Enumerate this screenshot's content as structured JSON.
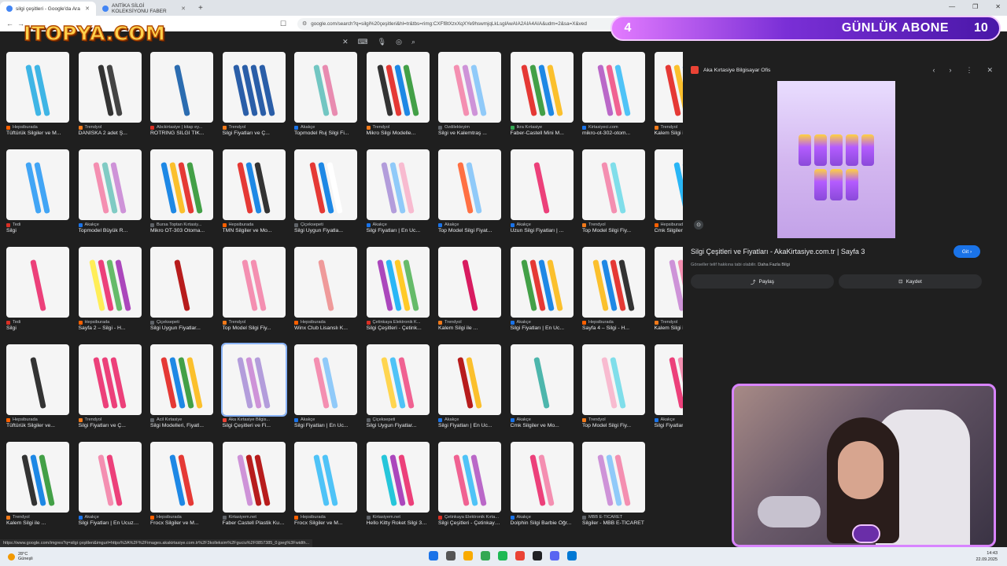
{
  "tabs": [
    {
      "label": "silgi çeşitleri - Google'da Ara",
      "active": true
    },
    {
      "label": "ANTİKA SİLGİ KOLEKSİYONU FABER",
      "active": false
    }
  ],
  "url": "google.com/search?q=silgi%20çeşitleri&hl=tr&tbs=rimg:CXFf8tXzxXqXYe9hswmjqLkLsglAwAIA2AIA4AIA&udm=2&sa=X&ved",
  "overlay": {
    "logo": "ITOPYA.COM",
    "sub_count_left": "4",
    "sub_label": "GÜNLÜK ABONE",
    "sub_count_right": "10"
  },
  "grid": [
    [
      {
        "source": "Hepsiburada",
        "title": "Tüftürük Silgiler ve M...",
        "src_color": "#ff6000",
        "colors": [
          "#3fb5e5",
          "#3fb5e5"
        ]
      },
      {
        "source": "Trendyol",
        "title": "DANİSKA 2 adet Ş...",
        "src_color": "#f27a1a",
        "colors": [
          "#333333",
          "#444444"
        ]
      },
      {
        "source": "Abckirtasiye | kitap ey...",
        "title": "ROTRİNG SİLGİ TİK...",
        "src_color": "#d93025",
        "colors": [
          "#2b6cb0"
        ]
      },
      {
        "source": "Trendyol",
        "title": "Silgi Fiyatları ve Ç...",
        "src_color": "#f27a1a",
        "colors": [
          "#2a5ea8",
          "#2a5ea8",
          "#2a5ea8",
          "#2a5ea8"
        ]
      },
      {
        "source": "Akakçe",
        "title": "Topmodel Ruj Silgi Fi...",
        "src_color": "#1a73e8",
        "colors": [
          "#72c6c2",
          "#e88bb0"
        ]
      },
      {
        "source": "Trendyol",
        "title": "Mikro Silgi Modelle...",
        "src_color": "#f27a1a",
        "colors": [
          "#333333",
          "#e53935",
          "#1e88e5",
          "#43a047"
        ]
      },
      {
        "source": "Özdilekteyim",
        "title": "Silgi ve Kalemtraş ...",
        "src_color": "#5f6368",
        "colors": [
          "#f48fb1",
          "#ce93d8",
          "#90caf9"
        ]
      },
      {
        "source": "İkra Kırtasiye",
        "title": "Faber-Castell Mini M...",
        "src_color": "#34a853",
        "colors": [
          "#e53935",
          "#43a047",
          "#1e88e5",
          "#fbc02d"
        ]
      },
      {
        "source": "Kirtasiyeci.com",
        "title": "mikro-ot-302-otom...",
        "src_color": "#1a73e8",
        "colors": [
          "#ba68c8",
          "#f06292",
          "#4fc3f7"
        ]
      },
      {
        "source": "Trendyol",
        "title": "Kalem Silgi ile ...",
        "src_color": "#f27a1a",
        "colors": [
          "#e53935",
          "#fbc02d",
          "#1e88e5",
          "#43a047"
        ]
      }
    ],
    [
      {
        "source": "Tedi",
        "title": "Silgi",
        "src_color": "#d93025",
        "colors": [
          "#42a5f5",
          "#42a5f5"
        ]
      },
      {
        "source": "Akakçe",
        "title": "Topmodel Büyük R...",
        "src_color": "#1a73e8",
        "colors": [
          "#f48fb1",
          "#80cbc4",
          "#ce93d8"
        ]
      },
      {
        "source": "Bursa Toptan Kırtasiy...",
        "title": "Mikro OT-303 Otoma...",
        "src_color": "#5f6368",
        "colors": [
          "#1e88e5",
          "#fbc02d",
          "#e53935",
          "#43a047"
        ]
      },
      {
        "source": "Hepsiburada",
        "title": "TMN Silgiler ve Mo...",
        "src_color": "#ff6000",
        "colors": [
          "#e53935",
          "#1e88e5",
          "#333333"
        ]
      },
      {
        "source": "Çiçeksepeti",
        "title": "Silgi Uygun Fiyatla...",
        "src_color": "#5f6368",
        "colors": [
          "#e53935",
          "#1e88e5",
          "#ffffff"
        ]
      },
      {
        "source": "Akakçe",
        "title": "Silgi Fiyatları | En Uc...",
        "src_color": "#1a73e8",
        "colors": [
          "#b39ddb",
          "#90caf9",
          "#f8bbd0"
        ]
      },
      {
        "source": "Akakçe",
        "title": "Top Model Silgi Fiyat...",
        "src_color": "#1a73e8",
        "colors": [
          "#ff7043",
          "#90caf9"
        ]
      },
      {
        "source": "Akakçe",
        "title": "Uzun Silgi Fiyatları | ...",
        "src_color": "#1a73e8",
        "colors": [
          "#ec407a"
        ]
      },
      {
        "source": "Trendyol",
        "title": "Top Model Silgi Fiy...",
        "src_color": "#f27a1a",
        "colors": [
          "#f48fb1",
          "#80deea"
        ]
      },
      {
        "source": "Hepsiburada",
        "title": "Cmk Silgiler ve Mo...",
        "src_color": "#ff6000",
        "colors": [
          "#29b6f6",
          "#29b6f6"
        ]
      }
    ],
    [
      {
        "source": "Tedi",
        "title": "Silgi",
        "src_color": "#d93025",
        "colors": [
          "#ec407a"
        ]
      },
      {
        "source": "Hepsiburada",
        "title": "Sayfa 2 – Silgi - H...",
        "src_color": "#ff6000",
        "colors": [
          "#ffee58",
          "#ec407a",
          "#66bb6a",
          "#ab47bc"
        ]
      },
      {
        "source": "Çiçeksepeti",
        "title": "Silgi Uygun Fiyatlar...",
        "src_color": "#5f6368",
        "colors": [
          "#b71c1c"
        ]
      },
      {
        "source": "Trendyol",
        "title": "Top Model Silgi Fiy...",
        "src_color": "#f27a1a",
        "colors": [
          "#f48fb1",
          "#f48fb1"
        ]
      },
      {
        "source": "Hepsiburada",
        "title": "Winx Club Lisanslı K...",
        "src_color": "#ff6000",
        "colors": [
          "#ef9a9a"
        ]
      },
      {
        "source": "Çetinkaya Elektronik K...",
        "title": "Silgi Çeşitleri - Çetink...",
        "src_color": "#d93025",
        "colors": [
          "#ab47bc",
          "#29b6f6",
          "#ffca28",
          "#66bb6a"
        ]
      },
      {
        "source": "Trendyol",
        "title": "Kalem Silgi ile ...",
        "src_color": "#f27a1a",
        "colors": [
          "#d81b60"
        ]
      },
      {
        "source": "Akakçe",
        "title": "Silgi Fiyatları | En Uc...",
        "src_color": "#1a73e8",
        "colors": [
          "#43a047",
          "#e53935",
          "#1e88e5",
          "#fbc02d"
        ]
      },
      {
        "source": "Hepsiburada",
        "title": "Sayfa 4 – Silgi - H...",
        "src_color": "#ff6000",
        "colors": [
          "#fbc02d",
          "#1e88e5",
          "#e53935",
          "#333333"
        ]
      },
      {
        "source": "Trendyol",
        "title": "Kalem Silgi ile ...",
        "src_color": "#f27a1a",
        "colors": [
          "#ce93d8",
          "#f48fb1",
          "#90caf9"
        ]
      }
    ],
    [
      {
        "source": "Hepsiburada",
        "title": "Tüftürük Silgiler ve...",
        "src_color": "#ff6000",
        "colors": [
          "#333333"
        ]
      },
      {
        "source": "Trendyol",
        "title": "Silgi Fiyatları ve Ç...",
        "src_color": "#f27a1a",
        "colors": [
          "#ec407a",
          "#ec407a",
          "#ec407a"
        ]
      },
      {
        "source": "Acil Kırtasiye",
        "title": "Silgi Modelleri, Fiyatl...",
        "src_color": "#5f6368",
        "colors": [
          "#e53935",
          "#1e88e5",
          "#43a047",
          "#fbc02d"
        ]
      },
      {
        "source": "Aka Kırtasiye Bilgis...",
        "title": "Silgi Çeşitleri ve Fi...",
        "src_color": "#ea4335",
        "colors": [
          "#b39ddb",
          "#ce93d8",
          "#b39ddb"
        ],
        "selected": true
      },
      {
        "source": "Akakçe",
        "title": "Silgi Fiyatları | En Uc...",
        "src_color": "#1a73e8",
        "colors": [
          "#f48fb1",
          "#90caf9"
        ]
      },
      {
        "source": "Çiçeksepeti",
        "title": "Silgi Uygun Fiyatlar...",
        "src_color": "#5f6368",
        "colors": [
          "#ffd54f",
          "#4fc3f7",
          "#f06292"
        ]
      },
      {
        "source": "Akakçe",
        "title": "Silgi Fiyatları | En Uc...",
        "src_color": "#1a73e8",
        "colors": [
          "#b71c1c",
          "#fbc02d"
        ]
      },
      {
        "source": "Akakçe",
        "title": "Cmk Silgiler ve Mo...",
        "src_color": "#1a73e8",
        "colors": [
          "#4db6ac"
        ]
      },
      {
        "source": "Trendyol",
        "title": "Top Model Silgi Fiy...",
        "src_color": "#f27a1a",
        "colors": [
          "#f8bbd0",
          "#80deea"
        ]
      },
      {
        "source": "Akakçe",
        "title": "Silgi Fiyatları | En Uc...",
        "src_color": "#1a73e8",
        "colors": [
          "#ec407a",
          "#f48fb1",
          "#ec407a"
        ]
      }
    ],
    [
      {
        "source": "Trendyol",
        "title": "Kalem Silgi ile ...",
        "src_color": "#f27a1a",
        "colors": [
          "#333333",
          "#1e88e5",
          "#43a047"
        ]
      },
      {
        "source": "Akakçe",
        "title": "Silgi Fiyatları | En Ucuzu ...",
        "src_color": "#1a73e8",
        "colors": [
          "#f48fb1",
          "#ec407a"
        ]
      },
      {
        "source": "Hepsiburada",
        "title": "Frocx Silgiler ve M...",
        "src_color": "#ff6000",
        "colors": [
          "#1e88e5",
          "#e53935"
        ]
      },
      {
        "source": "Kirtasiyem.net",
        "title": "Faber Castell Plastik Kut...",
        "src_color": "#5f6368",
        "colors": [
          "#ce93d8",
          "#b71c1c",
          "#b71c1c"
        ]
      },
      {
        "source": "Hepsiburada",
        "title": "Frocx Silgiler ve M...",
        "src_color": "#ff6000",
        "colors": [
          "#4fc3f7",
          "#4fc3f7"
        ]
      },
      {
        "source": "Kirtasiyem.net",
        "title": "Hello Kitty Roket Silgi 36...",
        "src_color": "#5f6368",
        "colors": [
          "#26c6da",
          "#ab47bc",
          "#ec407a"
        ]
      },
      {
        "source": "Çetinkaya Elektronik Kırta...",
        "title": "Silgi Çeşitleri - Çetinkaya...",
        "src_color": "#d93025",
        "colors": [
          "#f06292",
          "#4fc3f7",
          "#ba68c8"
        ]
      },
      {
        "source": "Akakçe",
        "title": "Dolphin Silgi Barbie Öğr...",
        "src_color": "#1a73e8",
        "colors": [
          "#ec407a",
          "#f48fb1"
        ]
      },
      {
        "source": "MBB E-TİCARET",
        "title": "Silgiler - MBB E-TİCARET",
        "src_color": "#5f6368",
        "colors": [
          "#ce93d8",
          "#90caf9",
          "#f48fb1"
        ]
      }
    ]
  ],
  "panel": {
    "site": "Aka Kırtasiye Bilgisayar Ofis",
    "title": "Silgi Çeşitleri ve Fiyatları - AkaKirtasiye.com.tr | Sayfa 3",
    "go_label": "Git",
    "note": "Görseller telif hakkına tabi olabilir.",
    "note_link": "Daha Fazla Bilgi",
    "share_label": "Paylaş",
    "save_label": "Kaydet"
  },
  "status_url": "https://www.google.com/imgres?q=silgi çeşitleri&imgurl=https%3A%2F%2Fimages.akakirtasiye.com.tr%2F3kolleksim%2Fguciu%2F0857385_0.jpeg%3Fwidth...",
  "taskbar": {
    "temp": "28°C",
    "weather": "Güneşli",
    "time": "14:43",
    "date": "22.09.2025"
  },
  "colors": {
    "page_bg": "#1f1f1f",
    "accent": "#1a73e8",
    "banner_purple": "#7a2fd6"
  }
}
